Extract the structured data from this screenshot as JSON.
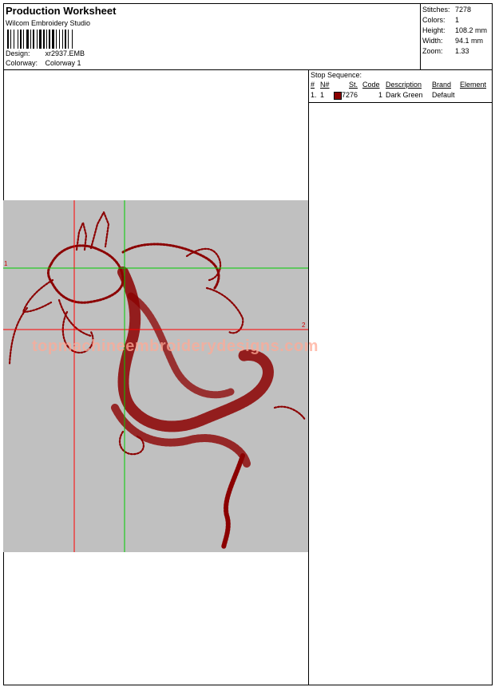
{
  "header": {
    "title": "Production Worksheet",
    "software": "Wilcom Embroidery Studio",
    "design_label": "Design:",
    "design_value": "xr2937.EMB",
    "colorway_label": "Colorway:",
    "colorway_value": "Colorway 1"
  },
  "stats": {
    "stitches_label": "Stitches:",
    "stitches_value": "7278",
    "colors_label": "Colors:",
    "colors_value": "1",
    "height_label": "Height:",
    "height_value": "108.2 mm",
    "width_label": "Width:",
    "width_value": "94.1 mm",
    "zoom_label": "Zoom:",
    "zoom_value": "1.33"
  },
  "stop_sequence": {
    "title": "Stop Sequence:",
    "columns": [
      "#",
      "N#",
      "St.",
      "Code",
      "Description",
      "Brand",
      "Element"
    ],
    "rows": [
      {
        "num": "1.",
        "n": "1",
        "st": "7276",
        "code": "1",
        "description": "Dark Green",
        "brand": "Default",
        "element": "",
        "color": "#8b0000"
      }
    ]
  },
  "design": {
    "watermark": "topmachineembroiderydesigns.com",
    "marker_1": "1",
    "marker_2": "2",
    "thread_color": "#8b0000",
    "crosshair_red": "#ff0000",
    "crosshair_green": "#00cc00"
  }
}
